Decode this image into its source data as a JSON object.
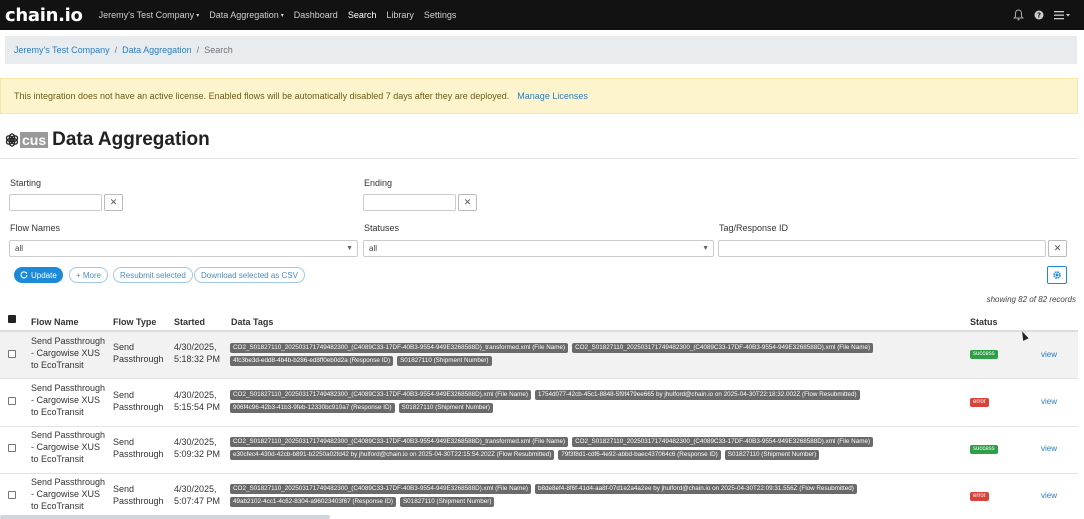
{
  "nav": {
    "logo": "chain.io",
    "items": [
      {
        "label": "Jeremy's Test Company",
        "caret": "▾"
      },
      {
        "label": "Data Aggregation",
        "caret": "▾"
      },
      {
        "label": "Dashboard",
        "caret": ""
      },
      {
        "label": "Search",
        "caret": ""
      },
      {
        "label": "Library",
        "caret": ""
      },
      {
        "label": "Settings",
        "caret": ""
      }
    ],
    "active": "Search"
  },
  "breadcrumb": [
    "Jeremy's Test Company",
    "Data Aggregation",
    "Search"
  ],
  "alert": {
    "text": "This integration does not have an active license. Enabled flows will be automatically disabled 7 days after they are deployed.",
    "link": "Manage Licenses"
  },
  "page": {
    "badge": "cus",
    "title": "Data Aggregation"
  },
  "filters": {
    "starting_label": "Starting",
    "ending_label": "Ending",
    "flow_names_label": "Flow Names",
    "flow_names_value": "all",
    "statuses_label": "Statuses",
    "statuses_value": "all",
    "tag_label": "Tag/Response ID",
    "clear_symbol": "✕"
  },
  "buttons": {
    "update": "Update",
    "more": "+ More",
    "resubmit": "Resubmit selected",
    "download": "Download selected as CSV"
  },
  "records_text": "showing 82 of 82 records",
  "table": {
    "headers": {
      "flow_name": "Flow Name",
      "flow_type": "Flow Type",
      "started": "Started",
      "data_tags": "Data Tags",
      "status": "Status"
    },
    "rows": [
      {
        "flow_name": [
          "Send Passthrough",
          "- Cargowise XUS",
          "to EcoTransit"
        ],
        "flow_type": [
          "Send",
          "Passthrough"
        ],
        "started": [
          "4/30/2025,",
          "5:18:32 PM"
        ],
        "tags": [
          "CO2_S01827110_20250317174948230​0_(C4089C33-17DF-40B3-9554-949E3268588D)_transformed.xml (File Name)",
          "CO2_S01827110_202503171749482300_(C4089C33-17DF-40B3-9554-949E3268588D).xml (File Name)",
          "4fc3be3d-edd8-4b4b-b286-ed8ff0eb0d2a (Response ID)",
          "S01827110 (Shipment Number)"
        ],
        "status": "success",
        "action": "view"
      },
      {
        "flow_name": [
          "Send Passthrough",
          "- Cargowise XUS",
          "to EcoTransit"
        ],
        "flow_type": [
          "Send",
          "Passthrough"
        ],
        "started": [
          "4/30/2025,",
          "5:15:54 PM"
        ],
        "tags": [
          "CO2_S01827110_202503171749482300_(C4089C33-17DF-40B3-9554-949E3268588D).xml (File Name)",
          "1754d077-42cb-45c1-8848-5f9f479ee665 by jhulford@chain.io on 2025-04-30T22:18:32.002Z (Flow Resubmitted)",
          "906f4c96-42b3-41b3-9feb-12330bc910a7 (Response ID)",
          "S01827110 (Shipment Number)"
        ],
        "status": "error",
        "action": "view"
      },
      {
        "flow_name": [
          "Send Passthrough",
          "- Cargowise XUS",
          "to EcoTransit"
        ],
        "flow_type": [
          "Send",
          "Passthrough"
        ],
        "started": [
          "4/30/2025,",
          "5:09:32 PM"
        ],
        "tags": [
          "CO2_S01827110_202503171749482300_(C4089C33-17DF-40B3-9554-949E3268588D)_transformed.xml (File Name)",
          "CO2_S01827110_202503171749482300_(C4089C33-17DF-40B3-9554-949E3268588D).xml (File Name)",
          "e30cfec4-430d-42cb-b891-b2250a02fd42 by jhulford@chain.io on 2025-04-30T22:15:54.202Z (Flow Resubmitted)",
          "79f3f8d1-cdf6-4e92-abbd-baec437064c6 (Response ID)",
          "S01827110 (Shipment Number)"
        ],
        "status": "success",
        "action": "view"
      },
      {
        "flow_name": [
          "Send Passthrough",
          "- Cargowise XUS",
          "to EcoTransit"
        ],
        "flow_type": [
          "Send",
          "Passthrough"
        ],
        "started": [
          "4/30/2025,",
          "5:07:47 PM"
        ],
        "tags": [
          "CO2_S01827110_202503171749482300_(C4089C33-17DF-40B3-9554-949E3268588D).xml (File Name)",
          "b8de8ef4-8f6f-41d4-aa8f-07d1e2a4a2ee by jhulford@chain.io on 2025-04-30T22:09:31.556Z (Flow Resubmitted)",
          "49ab2102-4cc1-4c62-8304-a96023403f67 (Response ID)",
          "S01827110 (Shipment Number)"
        ],
        "status": "error",
        "action": "view"
      }
    ]
  },
  "colors": {
    "accent": "#1c8ad8",
    "success": "#2e9e47",
    "error": "#d9443a",
    "alert_bg": "#fdf4cd",
    "nav_bg": "#121212"
  },
  "icons": {
    "bell": "bell-icon",
    "help": "help-icon",
    "menu": "menu-icon",
    "refresh": "refresh-icon",
    "gear": "gear-icon",
    "swirl": "openai-swirl-icon"
  }
}
